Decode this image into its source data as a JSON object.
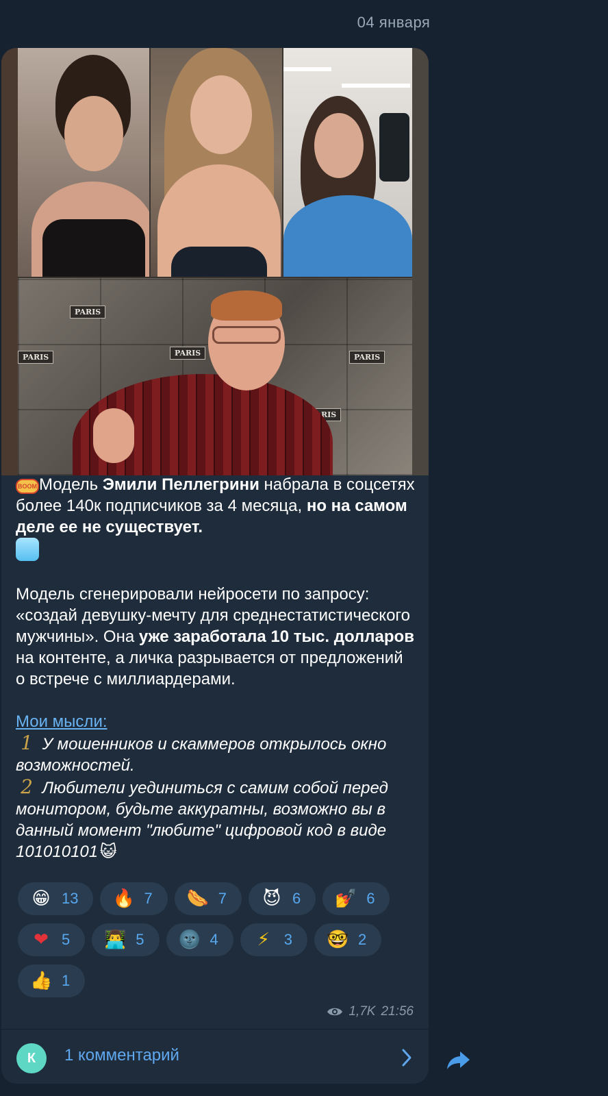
{
  "date_label": "04 января",
  "post": {
    "paragraph1": {
      "text_a": "Модель ",
      "bold_a": "Эмили Пеллегрини",
      "text_b": " набрала в соцсетях более 140к подписчиков за 4 месяца, ",
      "bold_b": "но на самом деле ее не существует."
    },
    "paragraph2": {
      "text_a": "Модель сгенерировали нейросети по запросу: «создай девушку-мечту для среднестатистического мужчины». Она ",
      "bold_a": "уже заработала 10 тыс. долларов",
      "text_b": " на контенте, а личка разрывается от предложений о встрече с миллиардерами."
    },
    "thoughts_link": "Мои мысли:",
    "thought1_num": "1",
    "thought1": " У мошенников и скаммеров открылось окно возможностей.",
    "thought2_num": "2",
    "thought2": " Любители уединиться с самим собой перед монитором, будьте аккуратны, возможно вы в данный момент \"любите\" цифровой код в виде 101010101",
    "photo_labels": [
      "PARIS",
      "PARIS",
      "PARIS",
      "PARIS",
      "PARIS"
    ],
    "boom_label": "BOOM"
  },
  "reactions_row1": [
    {
      "emoji": "😁",
      "count": "13"
    },
    {
      "emoji": "🔥",
      "count": "7"
    },
    {
      "emoji": "🌭",
      "count": "7"
    },
    {
      "emoji": "😈",
      "count": "6"
    },
    {
      "emoji": "💅",
      "count": "6"
    }
  ],
  "reactions_row2": [
    {
      "emoji": "❤",
      "count": "5"
    },
    {
      "emoji": "👨‍💻",
      "count": "5"
    },
    {
      "emoji": "🌚",
      "count": "4"
    },
    {
      "emoji": "⚡",
      "count": "3"
    },
    {
      "emoji": "🤓",
      "count": "2"
    }
  ],
  "reactions_row3": [
    {
      "emoji": "👍",
      "count": "1"
    }
  ],
  "meta": {
    "views": "1,7K",
    "time": "21:56"
  },
  "comments": {
    "avatar_letter": "К",
    "label": "1 комментарий"
  },
  "colors": {
    "background": "#172230",
    "bubble": "#1e2c3b",
    "accent": "#5fa8ef",
    "reaction_bg": "#2a3c4f"
  }
}
